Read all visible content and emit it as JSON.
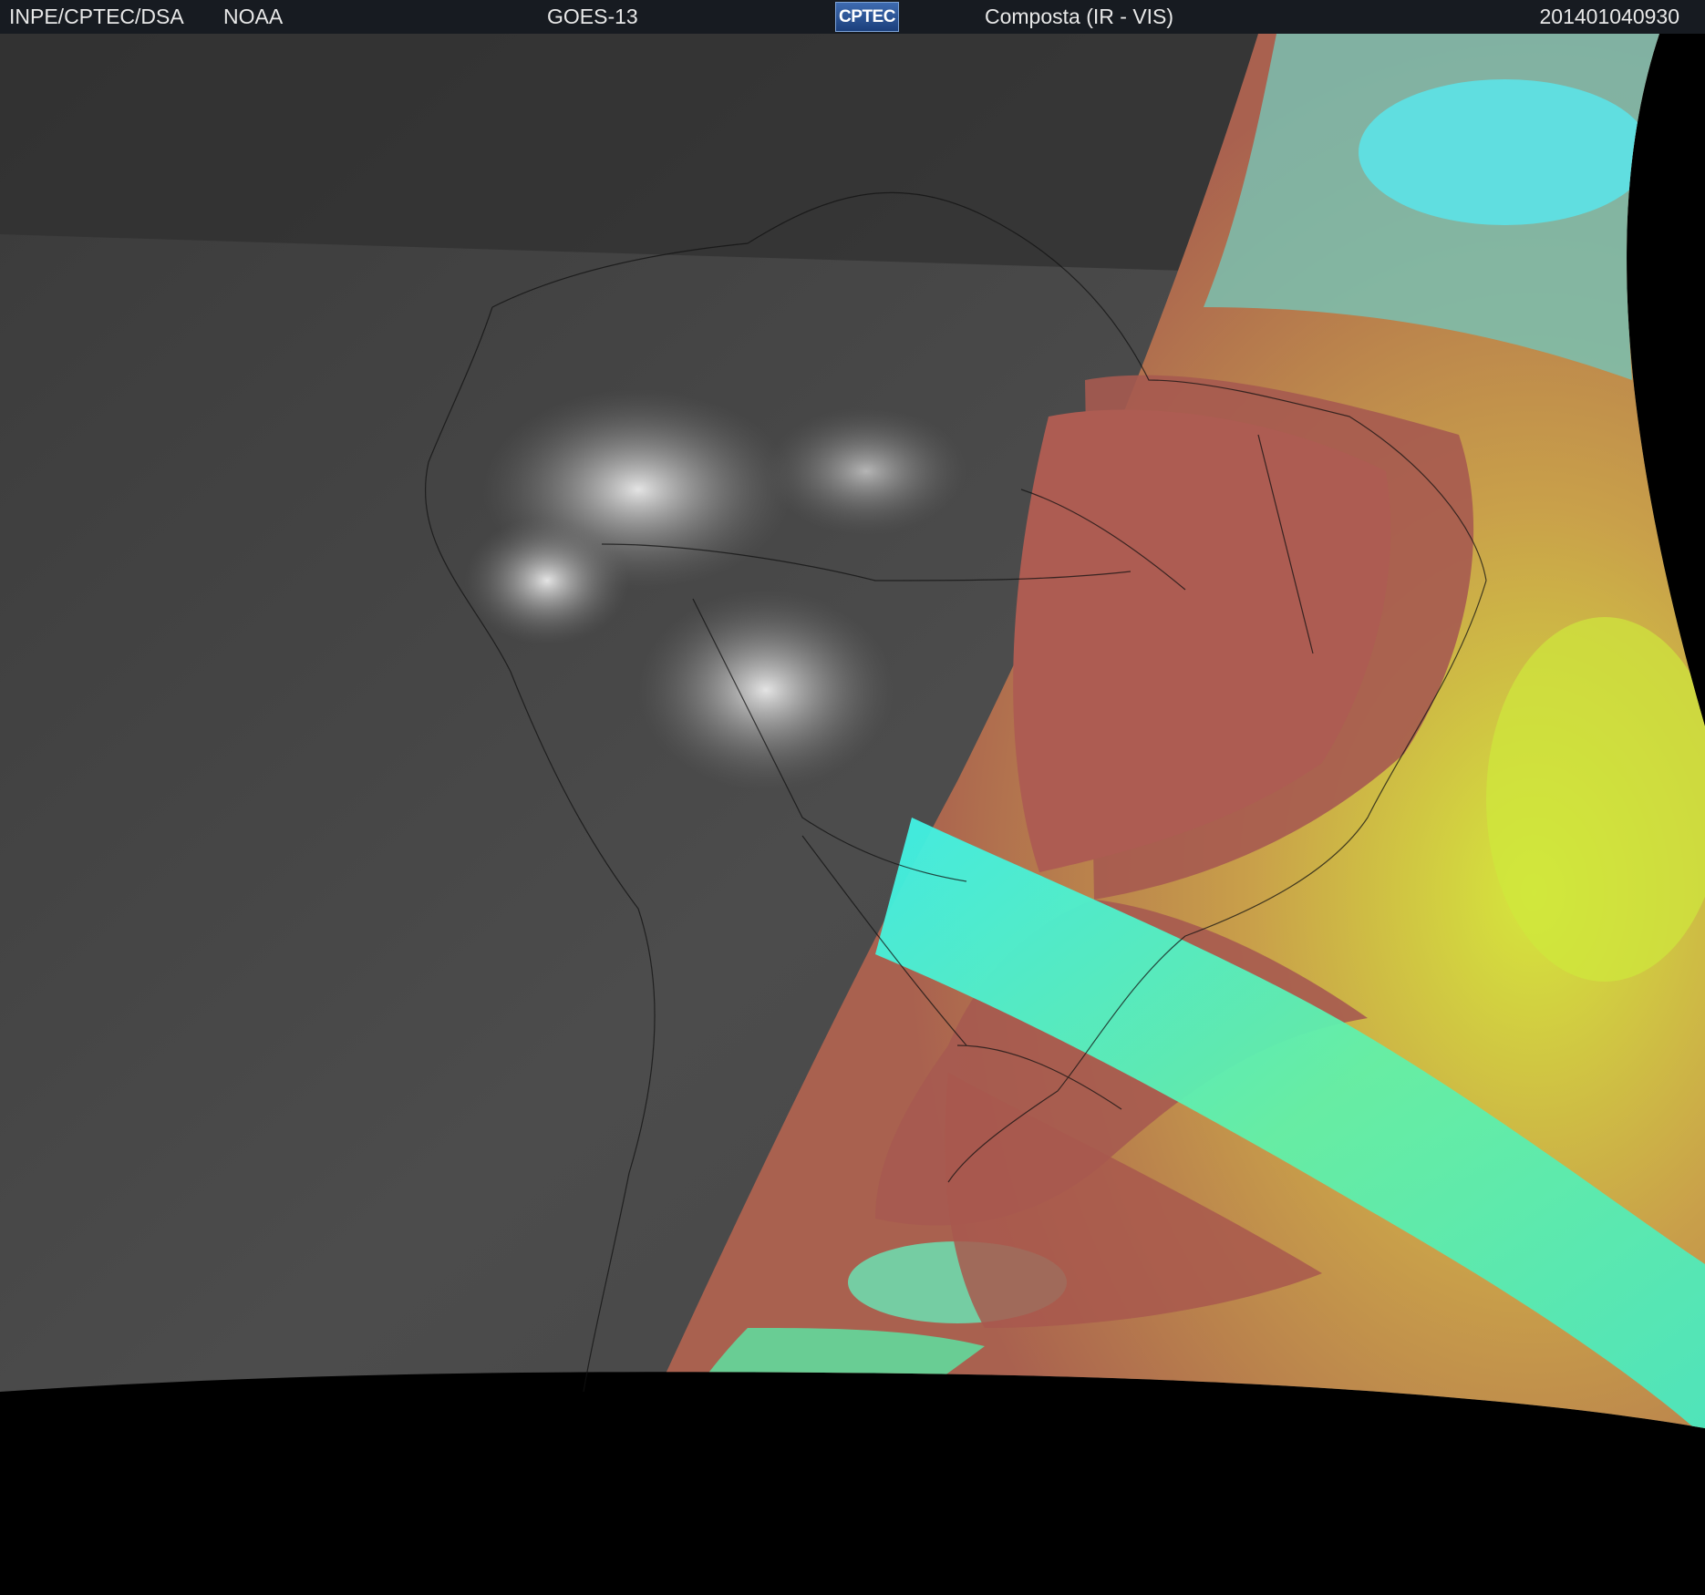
{
  "header": {
    "agency": "INPE/CPTEC/DSA",
    "partner": "NOAA",
    "satellite": "GOES-13",
    "logo_text": "CPTEC",
    "product": "Composta (IR - VIS)",
    "timestamp": "201401040930"
  },
  "colors": {
    "header_bg": "#171b21",
    "night_ir": "#4a4a4a",
    "day_land_red": "#a85a4e",
    "day_cloud_cyan": "#4ff0d8",
    "day_cloud_yellow": "#c8e840",
    "space": "#000000"
  }
}
